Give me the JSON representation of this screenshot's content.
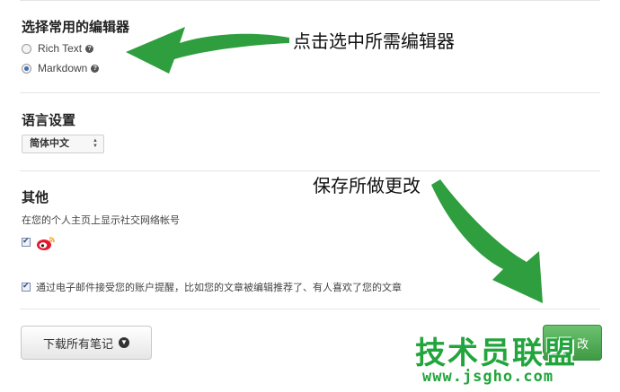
{
  "editor_section": {
    "title": "选择常用的编辑器",
    "options": [
      {
        "label": "Rich Text",
        "checked": false
      },
      {
        "label": "Markdown",
        "checked": true
      }
    ],
    "help_glyph": "?"
  },
  "language_section": {
    "title": "语言设置",
    "selected": "简体中文"
  },
  "other_section": {
    "title": "其他",
    "social_desc": "在您的个人主页上显示社交网络帐号",
    "weibo_checked": true,
    "email_checked": true,
    "email_label": "通过电子邮件接受您的账户提醒，比如您的文章被编辑推荐了、有人喜欢了您的文章"
  },
  "buttons": {
    "download_label": "下载所有笔记",
    "save_label": "改"
  },
  "annotations": {
    "editor_note": "点击选中所需编辑器",
    "save_note": "保存所做更改"
  },
  "watermark": {
    "brand": "技术员联盟",
    "url": "www.jsgho.com"
  },
  "colors": {
    "arrow_green": "#2e9e3e",
    "save_green": "#4caf50",
    "watermark_green": "#22a53c"
  }
}
